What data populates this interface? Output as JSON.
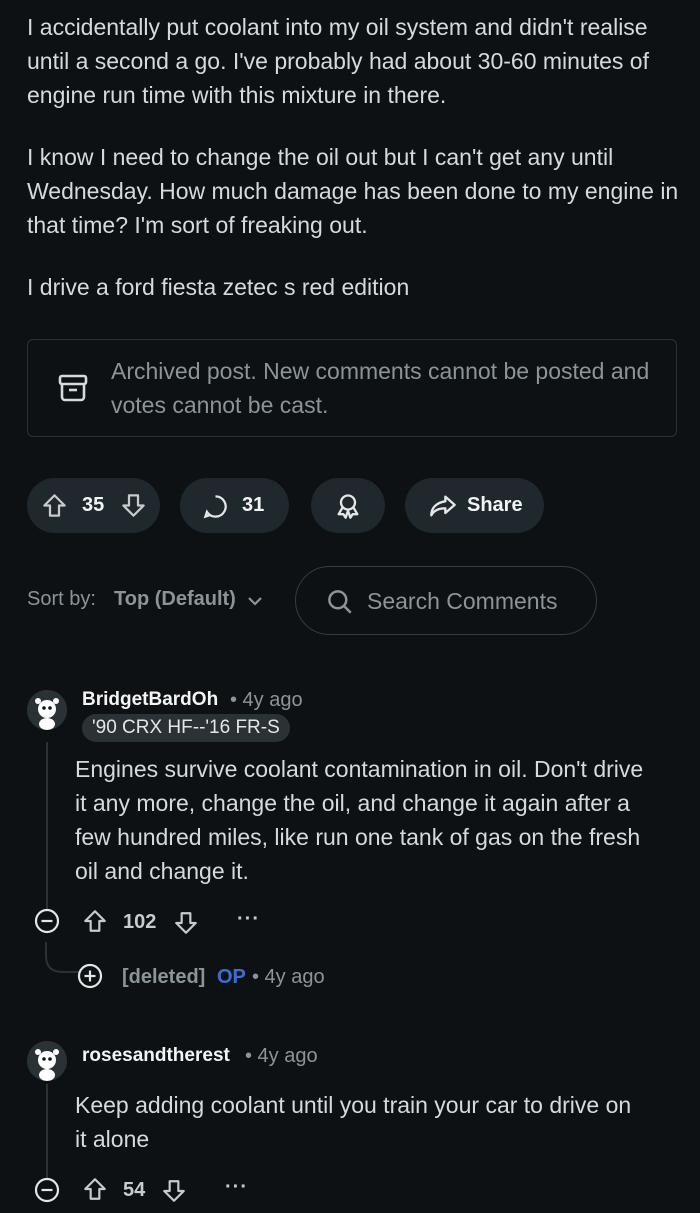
{
  "post": {
    "paragraphs": [
      "I accidentally put coolant into my oil system and didn't realise until a second a go. I've probably had about 30-60 minutes of engine run time with this mixture in there.",
      "I know I need to change the oil out but I can't get any until Wednesday. How much damage has been done to my engine in that time? I'm sort of freaking out.",
      "I drive a ford fiesta zetec s red edition"
    ],
    "archived_notice": "Archived post. New comments cannot be posted and votes cannot be cast.",
    "votes": "35",
    "comments_count": "31",
    "share_label": "Share"
  },
  "sort": {
    "label": "Sort by:",
    "value": "Top (Default)",
    "search_placeholder": "Search Comments"
  },
  "comments": [
    {
      "username": "BridgetBardOh",
      "meta": "• 4y ago",
      "flair": "'90 CRX HF--'16 FR-S",
      "lines": [
        "Engines survive coolant contamination in oil. Don't drive",
        "it any more, change the oil, and change it again after a",
        "few hundred miles, like run one tank of gas on the fresh",
        "oil and change it."
      ],
      "votes": "102",
      "reply": {
        "username": "[deleted]",
        "op": "OP",
        "meta": "• 4y ago"
      }
    },
    {
      "username": "rosesandtherest",
      "meta": "• 4y ago",
      "lines": [
        "Keep adding coolant until you train your car to drive on",
        "it alone"
      ],
      "votes": "54"
    }
  ],
  "colors": {
    "background": "#0e1113",
    "pill": "#1f282d",
    "text": "#d7dadc",
    "muted": "#8b9499",
    "op": "#3b6fd6"
  }
}
